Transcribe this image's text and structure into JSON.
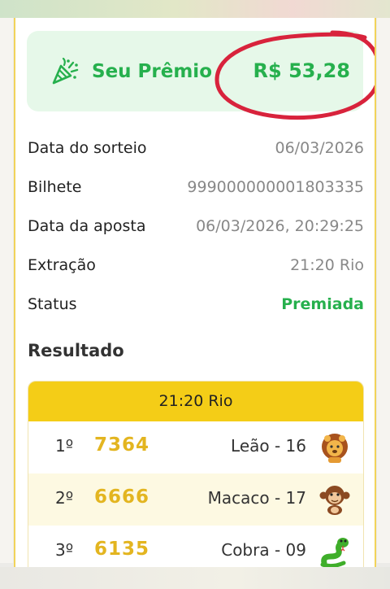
{
  "prize": {
    "label": "Seu Prêmio",
    "amount": "R$ 53,28"
  },
  "details": [
    {
      "label": "Data do sorteio",
      "value": "06/03/2026"
    },
    {
      "label": "Bilhete",
      "value": "999000000001803335"
    },
    {
      "label": "Data da aposta",
      "value": "06/03/2026, 20:29:25"
    },
    {
      "label": "Extração",
      "value": "21:20 Rio"
    },
    {
      "label": "Status",
      "value": "Premiada"
    }
  ],
  "result_title": "Resultado",
  "results": {
    "header": "21:20 Rio",
    "rows": [
      {
        "position": "1º",
        "number": "7364",
        "animal": "Leão - 16",
        "icon": "lion-icon"
      },
      {
        "position": "2º",
        "number": "6666",
        "animal": "Macaco - 17",
        "icon": "monkey-icon"
      },
      {
        "position": "3º",
        "number": "6135",
        "animal": "Cobra - 09",
        "icon": "snake-icon"
      }
    ]
  },
  "colors": {
    "accent_green": "#26b04d",
    "gold": "#f4cd17",
    "number_gold": "#e3b520",
    "marker_red": "#d8233c"
  }
}
